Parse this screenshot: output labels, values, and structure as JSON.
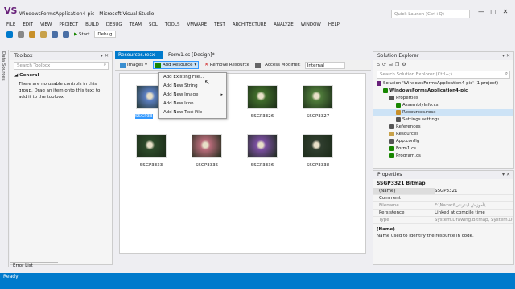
{
  "window": {
    "title": "WindowsFormsApplication4-pic - Microsoft Visual Studio",
    "logo": "VS",
    "quick_launch": "Quick Launch (Ctrl+Q)",
    "minimize": "—",
    "maximize": "□",
    "close": "✕"
  },
  "menu": [
    "FILE",
    "EDIT",
    "VIEW",
    "PROJECT",
    "BUILD",
    "DEBUG",
    "TEAM",
    "SQL",
    "TOOLS",
    "VMWARE",
    "TEST",
    "ARCHITECTURE",
    "ANALYZE",
    "WINDOW",
    "HELP"
  ],
  "toolbar": {
    "start_label": "Start",
    "config": "Debug",
    "arrow": "▶"
  },
  "side_tab": "Data Sources",
  "toolbox": {
    "title": "Toolbox",
    "pin": "▾ ✕",
    "search_placeholder": "Search Toolbox",
    "group": "General",
    "empty_text": "There are no usable controls in this group. Drag an item onto this text to add it to the toolbox"
  },
  "tabs": {
    "active": "Resources.resx",
    "inactive": "Form1.cs [Design]*"
  },
  "res_toolbar": {
    "images": "Images",
    "add_resource": "Add Resource",
    "remove_resource": "Remove Resource",
    "access_label": "Access Modifier:",
    "access_value": "Internal"
  },
  "dropdown": [
    "Add Existing File...",
    "Add New String",
    "Add New Image",
    "Add New Icon",
    "Add New Text File"
  ],
  "dropdown_arrow": "▸",
  "resources": [
    {
      "name": "SSGP3321",
      "selected": true,
      "color": "#5a7dbf"
    },
    {
      "name": "SSGP3322",
      "selected": false,
      "color": "#8b3a4e"
    },
    {
      "name": "SSGP3326",
      "selected": false,
      "color": "#3f6b2a"
    },
    {
      "name": "SSGP3327",
      "selected": false,
      "color": "#4e7a3a"
    },
    {
      "name": "SSGP3333",
      "selected": false,
      "color": "#2d4a2a"
    },
    {
      "name": "SSGP3335",
      "selected": false,
      "color": "#b86b7a"
    },
    {
      "name": "SSGP3336",
      "selected": false,
      "color": "#7a4ea0"
    },
    {
      "name": "SSGP3338",
      "selected": false,
      "color": "#2f3d2e"
    }
  ],
  "solution": {
    "title": "Solution Explorer",
    "pin": "▾ ✕",
    "search_placeholder": "Search Solution Explorer (Ctrl+;)",
    "items": [
      {
        "label": "Solution 'WindowsFormsApplication4-pic' (1 project)",
        "indent": 0,
        "selected": false,
        "icon": "#68217a"
      },
      {
        "label": "WindowsFormsApplication4-pic",
        "indent": 1,
        "selected": false,
        "bold": true,
        "icon": "#178600"
      },
      {
        "label": "Properties",
        "indent": 2,
        "selected": false,
        "icon": "#555"
      },
      {
        "label": "AssemblyInfo.cs",
        "indent": 3,
        "selected": false,
        "icon": "#178600"
      },
      {
        "label": "Resources.resx",
        "indent": 3,
        "selected": true,
        "icon": "#c8902a"
      },
      {
        "label": "Settings.settings",
        "indent": 3,
        "selected": false,
        "icon": "#555"
      },
      {
        "label": "References",
        "indent": 2,
        "selected": false,
        "icon": "#555"
      },
      {
        "label": "Resources",
        "indent": 2,
        "selected": false,
        "icon": "#c8a14a"
      },
      {
        "label": "App.config",
        "indent": 2,
        "selected": false,
        "icon": "#555"
      },
      {
        "label": "Form1.cs",
        "indent": 2,
        "selected": false,
        "icon": "#178600"
      },
      {
        "label": "Program.cs",
        "indent": 2,
        "selected": false,
        "icon": "#178600"
      }
    ]
  },
  "properties": {
    "title": "Properties",
    "pin": "▾ ✕",
    "object": "SSGP3321  Bitmap",
    "rows": [
      {
        "k": "(Name)",
        "v": "SSGP3321",
        "grey": false,
        "selected": true
      },
      {
        "k": "Comment",
        "v": "",
        "grey": false,
        "selected": false
      },
      {
        "k": "Filename",
        "v": "F:\\Nazari\\آموزش اینترنتی\\...",
        "grey": true,
        "selected": false
      },
      {
        "k": "Persistence",
        "v": "Linked at compile time",
        "grey": false,
        "selected": false
      },
      {
        "k": "Type",
        "v": "System.Drawing.Bitmap, System.D",
        "grey": true,
        "selected": false
      }
    ],
    "desc_title": "(Name)",
    "desc_text": "Name used to identify the resource in code."
  },
  "error_list": "Error List",
  "status": "Ready",
  "colors": {
    "accent": "#007acc",
    "selection": "#3399ff"
  }
}
